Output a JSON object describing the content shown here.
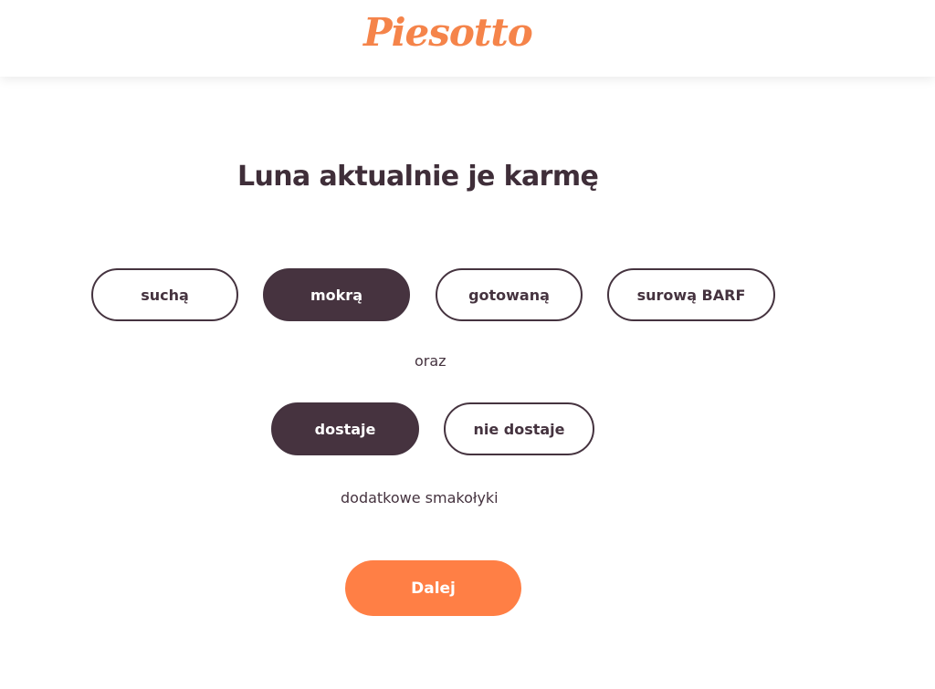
{
  "header": {
    "logo_text": "Piesotto"
  },
  "question": {
    "title": "Luna aktualnie je karmę"
  },
  "food_types": {
    "options": [
      {
        "label": "suchą",
        "selected": false
      },
      {
        "label": "mokrą",
        "selected": true
      },
      {
        "label": "gotowaną",
        "selected": false
      },
      {
        "label": "surową BARF",
        "selected": false
      }
    ]
  },
  "connector_text": "oraz",
  "treats": {
    "options": [
      {
        "label": "dostaje",
        "selected": true
      },
      {
        "label": "nie dostaje",
        "selected": false
      }
    ],
    "suffix_text": "dodatkowe smakołyki"
  },
  "next_button": {
    "label": "Dalej"
  },
  "colors": {
    "brand_orange": "#f5844a",
    "button_orange": "#ff7f45",
    "selected_dark": "#46333f",
    "text_dark": "#3f2e39",
    "background": "#ffffff"
  }
}
